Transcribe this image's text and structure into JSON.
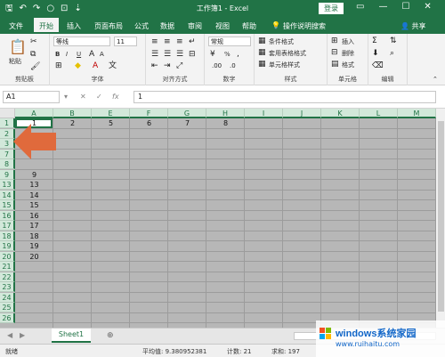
{
  "titlebar": {
    "title": "工作簿1 - Excel",
    "login": "登录",
    "qat_icons": [
      "save-icon",
      "undo-icon",
      "redo-icon",
      "shape-icon",
      "camera-icon",
      "customize-icon"
    ]
  },
  "tabs": [
    "文件",
    "开始",
    "插入",
    "页面布局",
    "公式",
    "数据",
    "审阅",
    "视图",
    "帮助",
    "操作说明搜索"
  ],
  "active_tab": "开始",
  "share": "共享",
  "ribbon": {
    "clipboard": {
      "paste": "粘贴",
      "label": "剪贴板"
    },
    "font": {
      "name": "等线",
      "size": "11",
      "label": "字体",
      "bold": "B",
      "italic": "I",
      "underline": "U"
    },
    "alignment": {
      "label": "对齐方式"
    },
    "number": {
      "format": "常规",
      "label": "数字",
      "percent": "%"
    },
    "styles": {
      "conditional": "条件格式",
      "table": "套用表格格式",
      "cell": "单元格样式",
      "label": "样式"
    },
    "cells": {
      "insert": "插入",
      "delete": "删除",
      "format": "格式",
      "label": "单元格"
    },
    "editing": {
      "label": "编辑"
    }
  },
  "formula_bar": {
    "namebox": "A1",
    "fx": "fx",
    "value": "1"
  },
  "columns": [
    "A",
    "B",
    "E",
    "F",
    "G",
    "H",
    "I",
    "J",
    "K",
    "L",
    "M"
  ],
  "rows": [
    "1",
    "2",
    "3",
    "7",
    "8",
    "9",
    "13",
    "14",
    "15",
    "16",
    "17",
    "18",
    "19",
    "20",
    "21",
    "22",
    "23",
    "24",
    "25",
    "26"
  ],
  "cells": {
    "r1": [
      "1",
      "2",
      "5",
      "6",
      "7",
      "8"
    ],
    "colA": [
      "9",
      "13",
      "14",
      "15",
      "16",
      "17",
      "18",
      "19",
      "20"
    ]
  },
  "sheet_tab": "Sheet1",
  "status": {
    "ready": "就绪",
    "average": "平均值: 9.380952381",
    "count": "计数: 21",
    "sum": "求和: 197"
  },
  "watermark": {
    "brand": "windows系统家园",
    "url": "www.ruihaitu.com"
  }
}
